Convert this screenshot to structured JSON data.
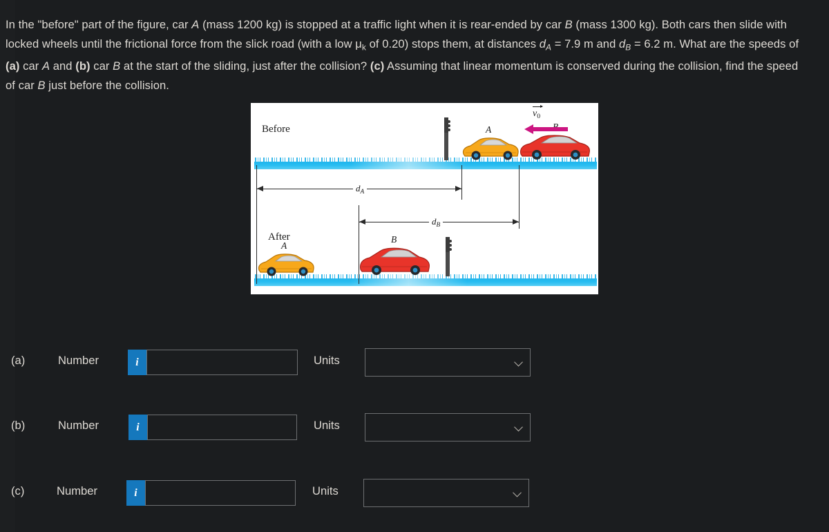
{
  "problem": {
    "segments": [
      {
        "t": "In the \"before\" part of the figure, car ",
        "style": "normal"
      },
      {
        "t": "A",
        "style": "italic"
      },
      {
        "t": " (mass 1200 kg) is stopped at a traffic light when it is rear-ended by car ",
        "style": "normal"
      },
      {
        "t": "B",
        "style": "italic"
      },
      {
        "t": " (mass 1300 kg). Both cars then slide with locked wheels until the frictional force from the slick road (with a low ",
        "style": "normal"
      },
      {
        "t": "μ",
        "style": "normal"
      },
      {
        "t": "k",
        "style": "sub-upright"
      },
      {
        "t": " of 0.20) stops them, at distances ",
        "style": "normal"
      },
      {
        "t": "d",
        "style": "italic"
      },
      {
        "t": "A",
        "style": "sub-italic"
      },
      {
        "t": " = 7.9 m and ",
        "style": "normal"
      },
      {
        "t": "d",
        "style": "italic"
      },
      {
        "t": "B",
        "style": "sub-italic"
      },
      {
        "t": " = 6.2 m. What are the speeds of ",
        "style": "normal"
      },
      {
        "t": "(a)",
        "style": "bold"
      },
      {
        "t": " car ",
        "style": "normal"
      },
      {
        "t": "A",
        "style": "italic"
      },
      {
        "t": " and ",
        "style": "normal"
      },
      {
        "t": "(b)",
        "style": "bold"
      },
      {
        "t": " car ",
        "style": "normal"
      },
      {
        "t": "B",
        "style": "italic"
      },
      {
        "t": " at the start of the sliding, just after the collision? ",
        "style": "normal"
      },
      {
        "t": "(c)",
        "style": "bold"
      },
      {
        "t": " Assuming that linear momentum is conserved during the collision, find the speed of car ",
        "style": "normal"
      },
      {
        "t": "B",
        "style": "italic"
      },
      {
        "t": " just before the collision.",
        "style": "normal"
      }
    ],
    "full_text": "In the \"before\" part of the figure, car A (mass 1200 kg) is stopped at a traffic light when it is rear-ended by car B (mass 1300 kg). Both cars then slide with locked wheels until the frictional force from the slick road (with a low μk of 0.20) stops them, at distances dA = 7.9 m and dB = 6.2 m. What are the speeds of (a) car A and (b) car B at the start of the sliding, just after the collision? (c) Assuming that linear momentum is conserved during the collision, find the speed of car B just before the collision."
  },
  "figure": {
    "before_label": "Before",
    "after_label": "After",
    "velocity_label": "v",
    "velocity_sub": "0",
    "dim_a_label": "d",
    "dim_a_sub": "A",
    "dim_b_label": "d",
    "dim_b_sub": "B",
    "car_a_tag_before": "A",
    "car_b_tag_before": "B",
    "car_a_tag_after": "A",
    "car_b_tag_after": "B",
    "colors": {
      "car_a": "#f7a81b",
      "car_b": "#e8342a",
      "road": "#27bdf1",
      "velocity_arrow": "#cc1581",
      "traffic_light": "#3b3b3b"
    }
  },
  "answers": {
    "units_placeholder": "",
    "rows": [
      {
        "paren": "(a)",
        "number_label": "Number",
        "info_glyph": "i",
        "number_value": "",
        "units_label": "Units",
        "units_value": ""
      },
      {
        "paren": "(b)",
        "number_label": "Number",
        "info_glyph": "i",
        "number_value": "",
        "units_label": "Units",
        "units_value": ""
      },
      {
        "paren": "(c)",
        "number_label": "Number",
        "info_glyph": "i",
        "number_value": "",
        "units_label": "Units",
        "units_value": ""
      }
    ]
  }
}
